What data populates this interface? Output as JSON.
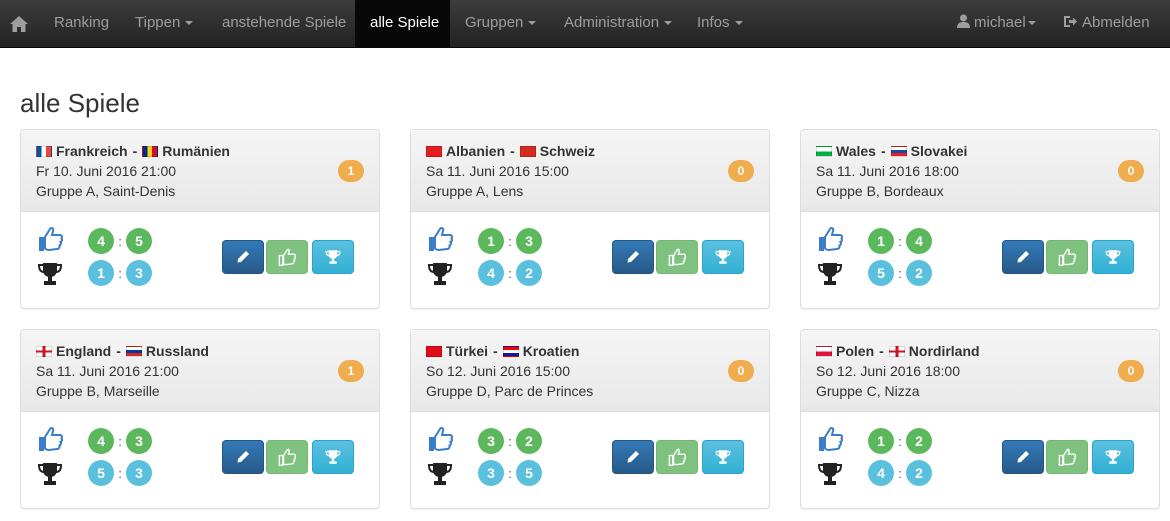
{
  "nav": {
    "home_icon": "home-icon",
    "items": [
      {
        "label": "Ranking"
      },
      {
        "label": "Tippen"
      },
      {
        "label": "anstehende Spiele"
      },
      {
        "label": "alle Spiele"
      },
      {
        "label": "Gruppen"
      },
      {
        "label": "Administration"
      },
      {
        "label": "Infos"
      }
    ],
    "user": "michael",
    "logout": "Abmelden"
  },
  "page_title": "alle Spiele",
  "colors": {
    "navbar": "#222222",
    "badge": "#f0ad4e",
    "green": "#5cb85c",
    "blue": "#5bc0de",
    "primary": "#337ab7"
  },
  "matches": [
    {
      "home": "Frankreich",
      "away": "Rumänien",
      "separator": "-",
      "date": "Fr 10. Juni 2016 21:00",
      "venue": "Gruppe A, Saint-Denis",
      "badge": "1",
      "tip": {
        "home": "4",
        "away": "5"
      },
      "result": {
        "home": "1",
        "away": "3"
      },
      "colon": ":"
    },
    {
      "home": "Albanien",
      "away": "Schweiz",
      "separator": "-",
      "date": "Sa 11. Juni 2016 15:00",
      "venue": "Gruppe A, Lens",
      "badge": "0",
      "tip": {
        "home": "1",
        "away": "3"
      },
      "result": {
        "home": "4",
        "away": "2"
      },
      "colon": ":"
    },
    {
      "home": "Wales",
      "away": "Slovakei",
      "separator": "-",
      "date": "Sa 11. Juni 2016 18:00",
      "venue": "Gruppe B, Bordeaux",
      "badge": "0",
      "tip": {
        "home": "1",
        "away": "4"
      },
      "result": {
        "home": "5",
        "away": "2"
      },
      "colon": ":"
    },
    {
      "home": "England",
      "away": "Russland",
      "separator": "-",
      "date": "Sa 11. Juni 2016 21:00",
      "venue": "Gruppe B, Marseille",
      "badge": "1",
      "tip": {
        "home": "4",
        "away": "3"
      },
      "result": {
        "home": "5",
        "away": "3"
      },
      "colon": ":"
    },
    {
      "home": "Türkei",
      "away": "Kroatien",
      "separator": "-",
      "date": "So 12. Juni 2016 15:00",
      "venue": "Gruppe D, Parc de Princes",
      "badge": "0",
      "tip": {
        "home": "3",
        "away": "2"
      },
      "result": {
        "home": "3",
        "away": "5"
      },
      "colon": ":"
    },
    {
      "home": "Polen",
      "away": "Nordirland",
      "separator": "-",
      "date": "So 12. Juni 2016 18:00",
      "venue": "Gruppe C, Nizza",
      "badge": "0",
      "tip": {
        "home": "1",
        "away": "2"
      },
      "result": {
        "home": "4",
        "away": "2"
      },
      "colon": ":"
    }
  ]
}
